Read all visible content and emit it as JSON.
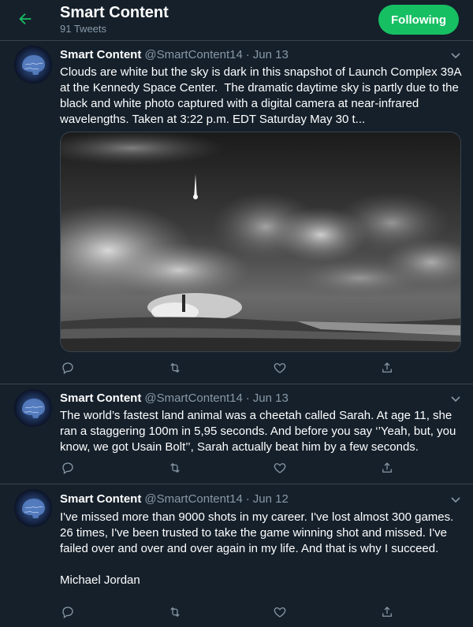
{
  "header": {
    "title": "Smart Content",
    "subtitle": "91 Tweets",
    "follow_label": "Following"
  },
  "icons": {
    "back": "arrow-left-icon",
    "caret": "chevron-down-icon",
    "reply": "reply-icon",
    "retweet": "retweet-icon",
    "like": "heart-icon",
    "share": "share-icon"
  },
  "colors": {
    "background": "#15202b",
    "accent": "#17bf63",
    "secondary_text": "#8899a6",
    "divider": "#38444d"
  },
  "tweets": [
    {
      "name": "Smart Content",
      "handle": "@SmartContent14",
      "separator": "·",
      "date": "Jun 13",
      "text": "Clouds are white but the sky is dark in this snapshot of Launch Complex 39A at the Kennedy Space Center.  The dramatic daytime sky is partly due to the black and white photo captured with a digital camera at near-infrared wavelengths. Taken at 3:22 p.m. EDT Saturday May 30 t...",
      "has_media": true
    },
    {
      "name": "Smart Content",
      "handle": "@SmartContent14",
      "separator": "·",
      "date": "Jun 13",
      "text": "The world’s fastest land animal was a cheetah called Sarah. At age 11, she ran a staggering 100m in 5,95 seconds. And before you say ‘’Yeah, but, you know, we got Usain Bolt’’, Sarah actually beat him by a few seconds.",
      "has_media": false
    },
    {
      "name": "Smart Content",
      "handle": "@SmartContent14",
      "separator": "·",
      "date": "Jun 12",
      "text": "I've missed more than 9000 shots in my career. I've lost almost 300 games. 26 times, I've been trusted to take the game winning shot and missed. I've failed over and over and over again in my life. And that is why I succeed.\n\nMichael Jordan",
      "has_media": false
    }
  ]
}
